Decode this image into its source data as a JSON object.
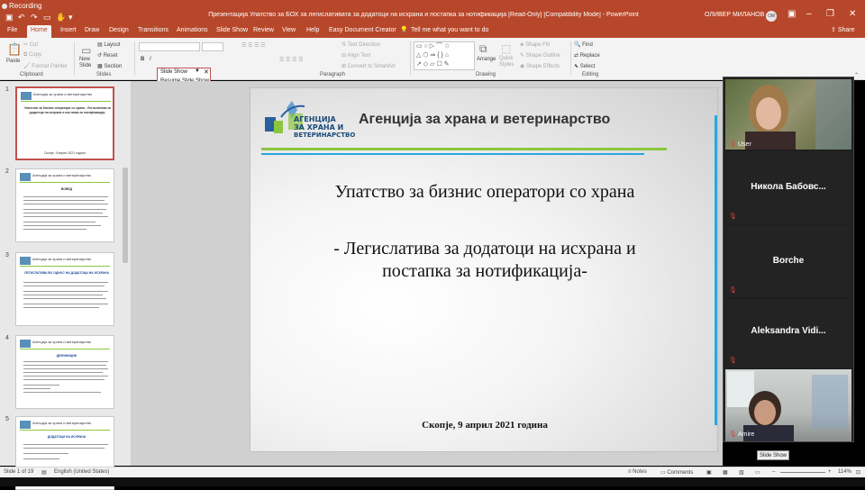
{
  "recording": {
    "label": "Recording"
  },
  "window": {
    "title": "Презентација Упатство за БОХ за легислативата за додатоци на исхрана и постапка за нотификација [Read-Only] [Compatibility Mode] - PowerPoint",
    "user": "ОЛИВЕР МИЛАНОВ",
    "avatar": "OM"
  },
  "ribbon_tabs": [
    "File",
    "Home",
    "Insert",
    "Draw",
    "Design",
    "Transitions",
    "Animations",
    "Slide Show",
    "Review",
    "View",
    "Help",
    "Easy Document Creator"
  ],
  "tell_me": "Tell me what you want to do",
  "share": "Share",
  "clipboard": {
    "paste": "Paste",
    "cut": "Cut",
    "copy": "Copy",
    "format_painter": "Format Painter",
    "group": "Clipboard"
  },
  "slides_group": {
    "new_slide": "New Slide",
    "layout": "Layout",
    "reset": "Reset",
    "section": "Section",
    "group": "Slides"
  },
  "paragraph": {
    "text_direction": "Text Direction",
    "align_text": "Align Text",
    "convert_smartart": "Convert to SmartArt",
    "group": "Paragraph"
  },
  "drawing": {
    "arrange": "Arrange",
    "quick_styles": "Quick Styles",
    "shape_fill": "Shape Fill",
    "shape_outline": "Shape Outline",
    "shape_effects": "Shape Effects",
    "group": "Drawing"
  },
  "editing": {
    "find": "Find",
    "replace": "Replace",
    "select": "Select",
    "group": "Editing"
  },
  "slideshow_popup": {
    "title": "Slide Show",
    "resume": "Resume Slide Show"
  },
  "thumbnails": [
    {
      "num": "1",
      "title": "Агенција за храна и ветеринарство",
      "body": "Упатство за бизнис оператори со храна - Легислатива за додатоци на исхрана и постапка за нотификација-",
      "foot": "Скопје, 9 април 2021 година"
    },
    {
      "num": "2",
      "title": "Агенција за храна и ветеринарство",
      "body": "ВОВЕД",
      "foot": ""
    },
    {
      "num": "3",
      "title": "Агенција за храна и ветеринарство",
      "body": "ЛЕГИСЛАТИВА ВО ОДНОС НА ДОДАТОЦИ НА ИСХРАНА",
      "foot": ""
    },
    {
      "num": "4",
      "title": "Агенција за храна и ветеринарство",
      "body": "ДЕФИНИЦИИ",
      "foot": ""
    },
    {
      "num": "5",
      "title": "Агенција за храна и ветеринарство",
      "body": "ДОДАТОЦИ НА ИСХРАНА",
      "foot": ""
    }
  ],
  "slide": {
    "logo_lines": [
      "АГЕНЦИЈА",
      "ЗА ХРАНА И",
      "ВЕТЕРИНАРСТВО"
    ],
    "agency": "Агенција за храна и ветеринарство",
    "title": "Упатство за бизнис оператори со храна",
    "subtitle_1": "- Легислатива за додатоци на исхрана и",
    "subtitle_2": "постапка за нотификација-",
    "date": "Скопје, 9 април 2021 година"
  },
  "participants": [
    {
      "name": "User",
      "type": "video"
    },
    {
      "name": "Никола  Бабовс...",
      "type": "name"
    },
    {
      "name": "Borche",
      "type": "name"
    },
    {
      "name": "Aleksandra  Vidi...",
      "type": "name"
    },
    {
      "name": "Amire",
      "type": "video"
    }
  ],
  "tooltip": "Slide Show",
  "status": {
    "slide_count": "Slide 1 of 19",
    "language": "English (United States)",
    "notes": "Notes",
    "comments": "Comments",
    "zoom": "114%"
  },
  "colors": {
    "accent": "#b7472a",
    "green_line": "#8cc63f",
    "blue_line": "#29a8e0"
  }
}
